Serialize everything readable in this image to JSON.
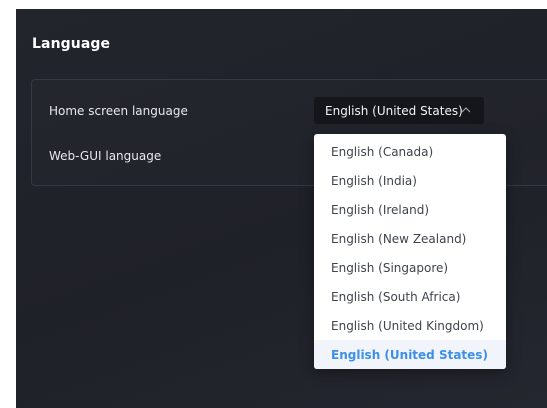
{
  "section": {
    "title": "Language"
  },
  "settings": {
    "home_screen_label": "Home screen language",
    "web_gui_label": "Web-GUI language"
  },
  "home_language_select": {
    "value": "English (United States)",
    "expanded": true,
    "chevron_icon": "chevron-up-icon"
  },
  "dropdown": {
    "options": [
      "English (Canada)",
      "English (India)",
      "English (Ireland)",
      "English (New Zealand)",
      "English (Singapore)",
      "English (South Africa)",
      "English (United Kingdom)",
      "English (United States)"
    ],
    "selected": "English (United States)"
  },
  "colors": {
    "background": "#1f2128",
    "panel_border": "#353844",
    "select_bg": "#15161b",
    "selected_option_text": "#3d8fe8"
  }
}
